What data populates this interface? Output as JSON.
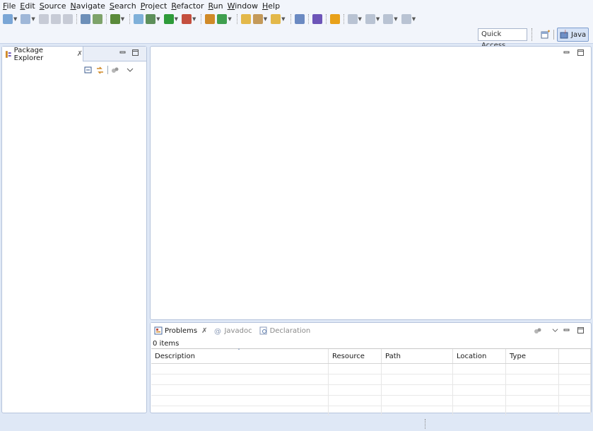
{
  "menu": [
    "File",
    "Edit",
    "Source",
    "Navigate",
    "Search",
    "Project",
    "Refactor",
    "Run",
    "Window",
    "Help"
  ],
  "toolbar": {
    "icons": [
      {
        "name": "new-wizard-icon",
        "color": "#7aa6d6",
        "arrow": true
      },
      {
        "name": "new-project-icon",
        "color": "#9fb7d8",
        "arrow": true
      },
      {
        "name": "save-icon",
        "color": "#c7cbd6",
        "arrow": false
      },
      {
        "name": "save-all-icon",
        "color": "#c7cbd6",
        "arrow": false
      },
      {
        "name": "print-icon",
        "color": "#c7cbd6",
        "arrow": false
      },
      {
        "name": "sep"
      },
      {
        "name": "build-icon",
        "color": "#6d8fb8",
        "arrow": false
      },
      {
        "name": "build-all-icon",
        "color": "#7ea36a",
        "arrow": false
      },
      {
        "name": "sep"
      },
      {
        "name": "task-icon",
        "color": "#5a8a3a",
        "arrow": true
      },
      {
        "name": "sep"
      },
      {
        "name": "open-type-icon",
        "color": "#7fb0d9",
        "arrow": false
      },
      {
        "name": "debug-icon",
        "color": "#5d8f5a",
        "arrow": true
      },
      {
        "name": "run-icon",
        "color": "#2e9b3a",
        "arrow": true
      },
      {
        "name": "external-tools-icon",
        "color": "#c44f3f",
        "arrow": true
      },
      {
        "name": "sep"
      },
      {
        "name": "coverage-icon",
        "color": "#d08a28",
        "arrow": false
      },
      {
        "name": "new-java-class-icon",
        "color": "#3f9f4f",
        "arrow": true
      },
      {
        "name": "sep"
      },
      {
        "name": "open-folder-icon",
        "color": "#e3b84a",
        "arrow": false
      },
      {
        "name": "pencil-icon",
        "color": "#c49a5a",
        "arrow": true
      },
      {
        "name": "open-file-icon",
        "color": "#e3b84a",
        "arrow": true
      },
      {
        "name": "sep"
      },
      {
        "name": "link-icon",
        "color": "#6b8ac2",
        "arrow": false
      },
      {
        "name": "sep"
      },
      {
        "name": "toggle-icon",
        "color": "#6d55b8",
        "arrow": false
      },
      {
        "name": "sep"
      },
      {
        "name": "stop-icon",
        "color": "#e8a11a",
        "arrow": false
      },
      {
        "name": "sep"
      },
      {
        "name": "next-annotation-icon",
        "color": "#b9c3d3",
        "arrow": true
      },
      {
        "name": "previous-annotation-icon",
        "color": "#b9c3d3",
        "arrow": true
      },
      {
        "name": "back-icon",
        "color": "#b9c3d3",
        "arrow": true
      },
      {
        "name": "forward-icon",
        "color": "#b9c3d3",
        "arrow": true
      }
    ]
  },
  "quick_access": {
    "label": "Quick Access"
  },
  "perspective": {
    "java_label": "Java"
  },
  "package_explorer": {
    "title": "Package Explorer",
    "close": "✗"
  },
  "problems": {
    "tabs": [
      {
        "label": "Problems",
        "active": true,
        "icon": "problems-icon"
      },
      {
        "label": "Javadoc",
        "active": false,
        "icon": "javadoc-icon"
      },
      {
        "label": "Declaration",
        "active": false,
        "icon": "declaration-icon"
      }
    ],
    "close": "✗",
    "count": "0 items",
    "columns": [
      {
        "label": "Description"
      },
      {
        "label": "Resource"
      },
      {
        "label": "Path"
      },
      {
        "label": "Location"
      },
      {
        "label": "Type"
      },
      {
        "label": ""
      }
    ],
    "empty_rows": 5
  },
  "colors": {
    "accent": "#7d9ccd",
    "background": "#dfe8f6"
  }
}
